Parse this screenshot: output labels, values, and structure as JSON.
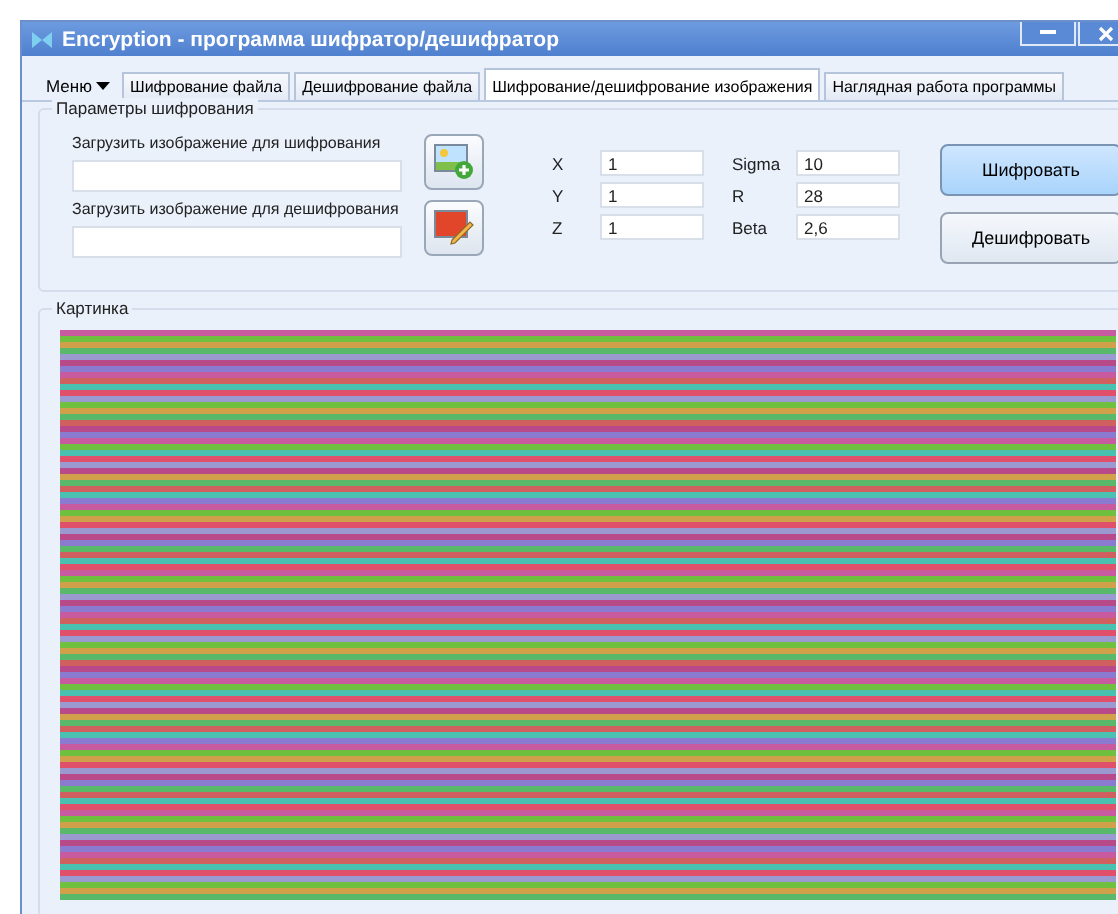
{
  "window": {
    "title": "Encryption - программа шифратор/дешифратор"
  },
  "menu": {
    "label": "Меню"
  },
  "tabs": [
    {
      "label": "Шифрование файла",
      "selected": false
    },
    {
      "label": "Дешифрование файла",
      "selected": false
    },
    {
      "label": "Шифрование/дешифрование изображения",
      "selected": true
    },
    {
      "label": "Наглядная работа программы",
      "selected": false
    }
  ],
  "params_group": {
    "title": "Параметры шифрования",
    "loads": [
      {
        "label": "Загрузить изображение для шифрования",
        "kind": "add"
      },
      {
        "label": "Загрузить изображение для дешифрования",
        "kind": "edit"
      }
    ],
    "params": [
      [
        {
          "label": "X",
          "value": "1"
        },
        {
          "label": "Y",
          "value": "1"
        },
        {
          "label": "Z",
          "value": "1"
        }
      ],
      [
        {
          "label": "Sigma",
          "value": "10"
        },
        {
          "label": "R",
          "value": "28"
        },
        {
          "label": "Beta",
          "value": "2,6"
        }
      ]
    ],
    "buttons": [
      {
        "label": "Шифровать",
        "default": true
      },
      {
        "label": "Дешифровать",
        "default": false
      }
    ]
  },
  "picture_group": {
    "title": "Картинка"
  }
}
